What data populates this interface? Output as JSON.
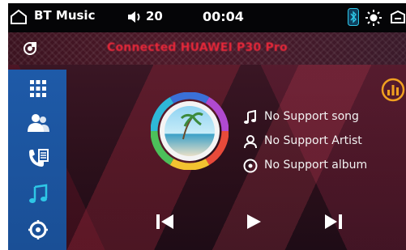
{
  "status_bar": {
    "app_title": "BT Music",
    "volume_level": "20",
    "time": "00:04"
  },
  "connection": {
    "status_text": "Connected HUAWEI P30 Pro"
  },
  "sidebar": {
    "items": [
      {
        "icon": "apps-grid-icon"
      },
      {
        "icon": "contacts-icon"
      },
      {
        "icon": "call-log-icon"
      },
      {
        "icon": "music-note-icon",
        "active": true
      },
      {
        "icon": "settings-icon"
      }
    ]
  },
  "track": {
    "song": "No Support song",
    "artist": "No Support Artist",
    "album": "No Support album"
  },
  "controls": [
    "previous-icon",
    "play-icon",
    "next-icon"
  ],
  "colors": {
    "accent_blue": "#1e5aa8",
    "active_cyan": "#2ec7e6",
    "connection_red": "#e8283a",
    "eq_gold": "#f0a020"
  }
}
